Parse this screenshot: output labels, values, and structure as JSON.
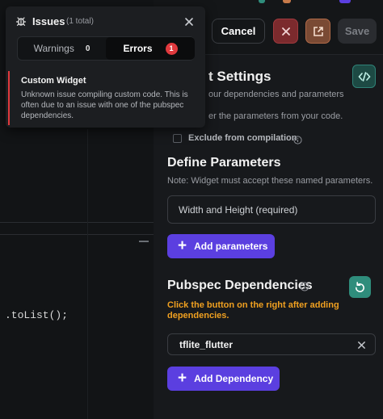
{
  "header": {
    "cancel_label": "Cancel",
    "save_label": "Save"
  },
  "settings": {
    "title": "t Settings",
    "subtitle_1": "our dependencies and parameters",
    "subtitle_2": "er the parameters from your code.",
    "exclude_label": "Exclude from compilation"
  },
  "parameters": {
    "heading": "Define Parameters",
    "description": "Note: Widget must accept these named parameters.",
    "input_value": "Width and Height (required)",
    "add_label": "Add parameters"
  },
  "pubspec": {
    "heading": "Pubspec Dependencies",
    "warning": "Click the button on the right after adding dependencies.",
    "dependencies": [
      "tflite_flutter"
    ],
    "add_label": "Add Dependency"
  },
  "editor": {
    "code_line": ".toList();"
  },
  "issues": {
    "title": "Issues",
    "count": "(1 total)",
    "tabs": {
      "warnings_label": "Warnings",
      "warnings_count": "0",
      "errors_label": "Errors",
      "errors_count": "1"
    },
    "items": [
      {
        "title": "Custom Widget",
        "message": "Unknown issue compiling custom code. This is often due to an issue with one of the pubspec dependencies."
      }
    ]
  },
  "colors": {
    "accent_purple": "#5b3fe0",
    "error_red": "#e0393d",
    "warning_orange": "#f0a020",
    "teal": "#2f8d7c"
  },
  "icons": {
    "bug": "bug-icon",
    "close": "close-icon",
    "code": "code-icon",
    "info": "info-icon",
    "refresh": "refresh-icon",
    "open": "open-in-new-icon"
  }
}
